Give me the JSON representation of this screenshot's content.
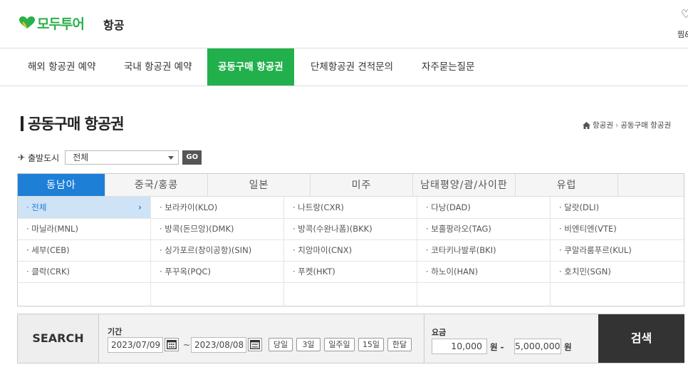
{
  "brand": {
    "logo_text": "모두투어",
    "section": "항공",
    "heart_color": "#2bb04a",
    "heart_accent": "#f0c419"
  },
  "topright": {
    "icon": "heart-icon",
    "label": "찜&"
  },
  "gnb": {
    "items": [
      {
        "label": "해외 항공권 예약"
      },
      {
        "label": "국내 항공권 예약"
      },
      {
        "label": "공동구매 항공권"
      },
      {
        "label": "단체항공권 견적문의"
      },
      {
        "label": "자주묻는질문"
      }
    ],
    "accent": "#21b04b"
  },
  "page": {
    "title": "공동구매 항공권",
    "breadcrumb": [
      "항공권",
      "공동구매 항공권"
    ]
  },
  "depart": {
    "label": "출발도시",
    "selected": "전체",
    "go": "GO"
  },
  "regions": {
    "tabs": [
      "동남아",
      "중국/홍콩",
      "일본",
      "미주",
      "남태평양/괌/사이판",
      "유럽"
    ],
    "active_color": "#1e7fd6",
    "cities": [
      [
        "· 전체",
        "· 보라카이(KLO)",
        "· 나트랑(CXR)",
        "· 다낭(DAD)",
        "· 달랏(DLI)"
      ],
      [
        "· 마닐라(MNL)",
        "· 방콕(돈므앙)(DMK)",
        "· 방콕(수완나폼)(BKK)",
        "· 보홀팡라오(TAG)",
        "· 비엔티엔(VTE)"
      ],
      [
        "· 세부(CEB)",
        "· 싱가포르(창이공항)(SIN)",
        "· 치앙마이(CNX)",
        "· 코타키나발루(BKI)",
        "· 쿠알라룸푸르(KUL)"
      ],
      [
        "· 클락(CRK)",
        "· 푸꾸옥(PQC)",
        "· 푸켓(HKT)",
        "· 하노이(HAN)",
        "· 호치민(SGN)"
      ]
    ],
    "active_chevron": "›"
  },
  "search": {
    "label": "SEARCH",
    "period_label": "기간",
    "date_from": "2023/07/09",
    "date_to": "2023/08/08",
    "tilde": "~",
    "quick": [
      "당일",
      "3일",
      "일주일",
      "15일",
      "한달"
    ],
    "fare_label": "요금",
    "fare_min": "10,000",
    "fare_max": "5,000,000",
    "unit_dash": "원 -",
    "unit": "원",
    "button": "검색"
  }
}
